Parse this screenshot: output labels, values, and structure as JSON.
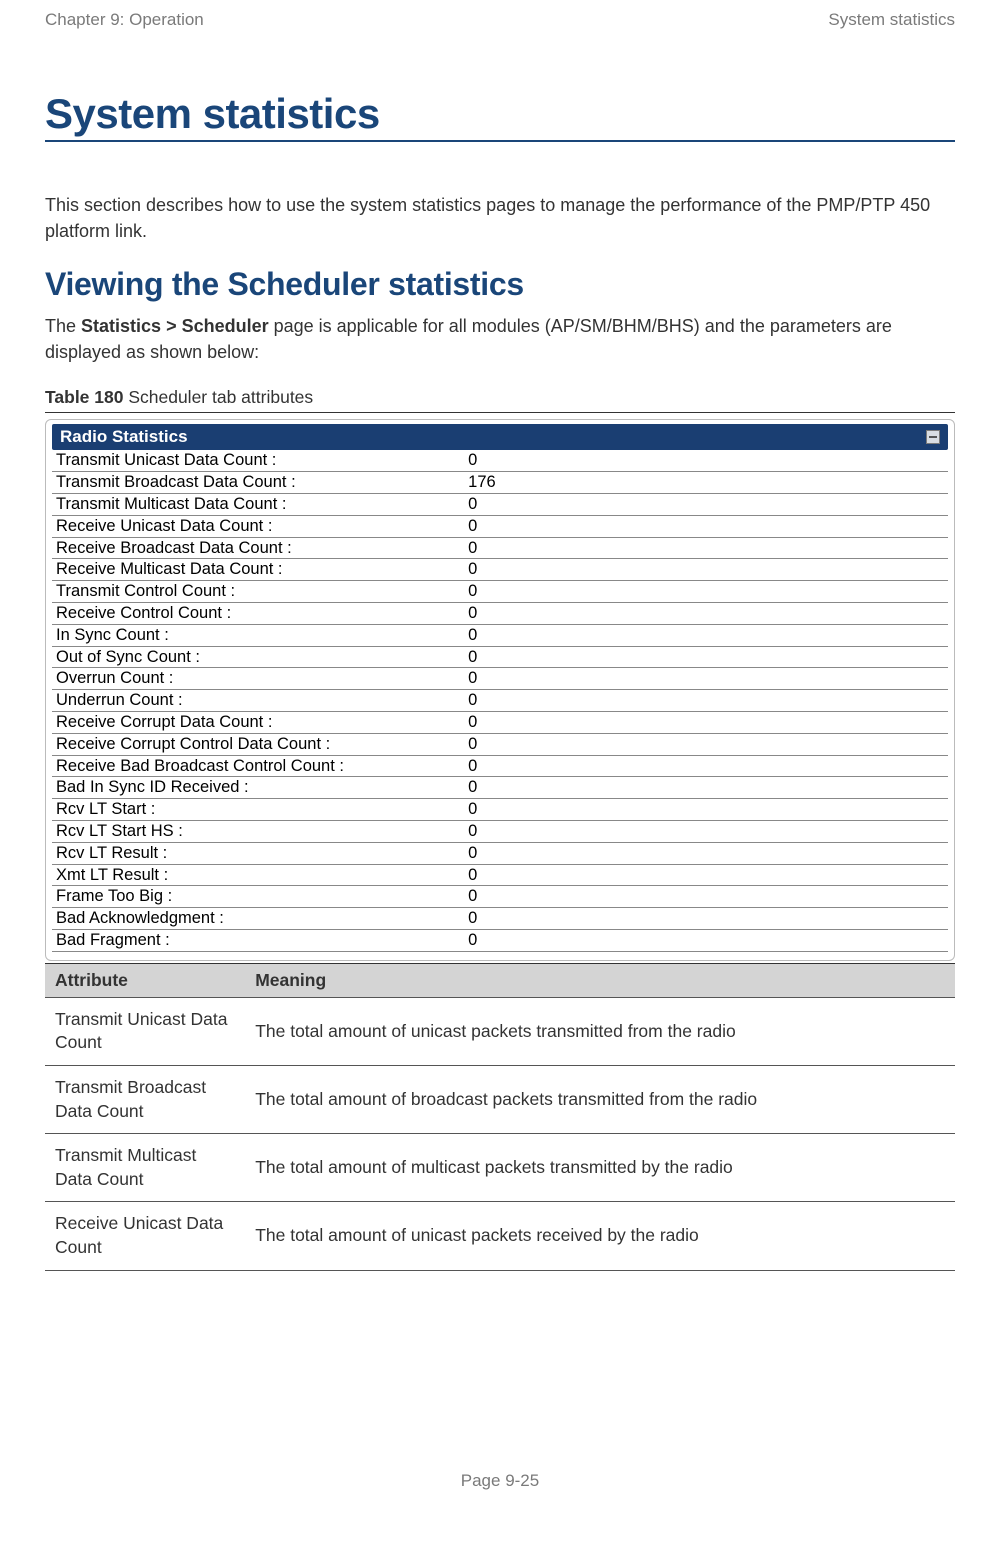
{
  "header": {
    "chapter": "Chapter 9:  Operation",
    "section": "System statistics"
  },
  "title": "System statistics",
  "intro": "This section describes how to use the system statistics pages to manage the performance of the PMP/PTP 450 platform link.",
  "subheading": "Viewing the Scheduler statistics",
  "subtext_pre": "The ",
  "subtext_bold": "Statistics > Scheduler",
  "subtext_post": " page is applicable for all modules (AP/SM/BHM/BHS) and the parameters are displayed as shown below:",
  "table_caption_bold": "Table 180",
  "table_caption_rest": " Scheduler tab attributes",
  "radio": {
    "panel_title": "Radio Statistics",
    "rows": [
      {
        "label": "Transmit Unicast Data Count :",
        "value": "0"
      },
      {
        "label": "Transmit Broadcast Data Count :",
        "value": "176"
      },
      {
        "label": "Transmit Multicast Data Count :",
        "value": "0"
      },
      {
        "label": "Receive Unicast Data Count :",
        "value": "0"
      },
      {
        "label": "Receive Broadcast Data Count :",
        "value": "0"
      },
      {
        "label": "Receive Multicast Data Count :",
        "value": "0"
      },
      {
        "label": "Transmit Control Count :",
        "value": "0"
      },
      {
        "label": "Receive Control Count :",
        "value": "0"
      },
      {
        "label": "In Sync Count :",
        "value": "0"
      },
      {
        "label": "Out of Sync Count :",
        "value": "0"
      },
      {
        "label": "Overrun Count :",
        "value": "0"
      },
      {
        "label": "Underrun Count :",
        "value": "0"
      },
      {
        "label": "Receive Corrupt Data Count :",
        "value": "0"
      },
      {
        "label": "Receive Corrupt Control Data Count :",
        "value": "0"
      },
      {
        "label": "Receive Bad Broadcast Control Count :",
        "value": "0"
      },
      {
        "label": "Bad In Sync ID Received :",
        "value": "0"
      },
      {
        "label": "Rcv LT Start :",
        "value": "0"
      },
      {
        "label": "Rcv LT Start HS :",
        "value": "0"
      },
      {
        "label": "Rcv LT Result :",
        "value": "0"
      },
      {
        "label": "Xmt LT Result :",
        "value": "0"
      },
      {
        "label": "Frame Too Big :",
        "value": "0"
      },
      {
        "label": "Bad Acknowledgment :",
        "value": "0"
      },
      {
        "label": "Bad Fragment :",
        "value": "0"
      }
    ]
  },
  "attr": {
    "head_attr": "Attribute",
    "head_meaning": "Meaning",
    "rows": [
      {
        "attr": "Transmit Unicast Data Count",
        "meaning": "The total amount of unicast packets transmitted from the radio"
      },
      {
        "attr": "Transmit Broadcast Data Count",
        "meaning": "The total amount of broadcast packets transmitted from the radio"
      },
      {
        "attr": "Transmit Multicast Data Count",
        "meaning": "The total amount of multicast packets transmitted by the radio"
      },
      {
        "attr": "Receive Unicast Data Count",
        "meaning": "The total amount of unicast packets received by the radio"
      }
    ]
  },
  "footer": "Page 9-25"
}
